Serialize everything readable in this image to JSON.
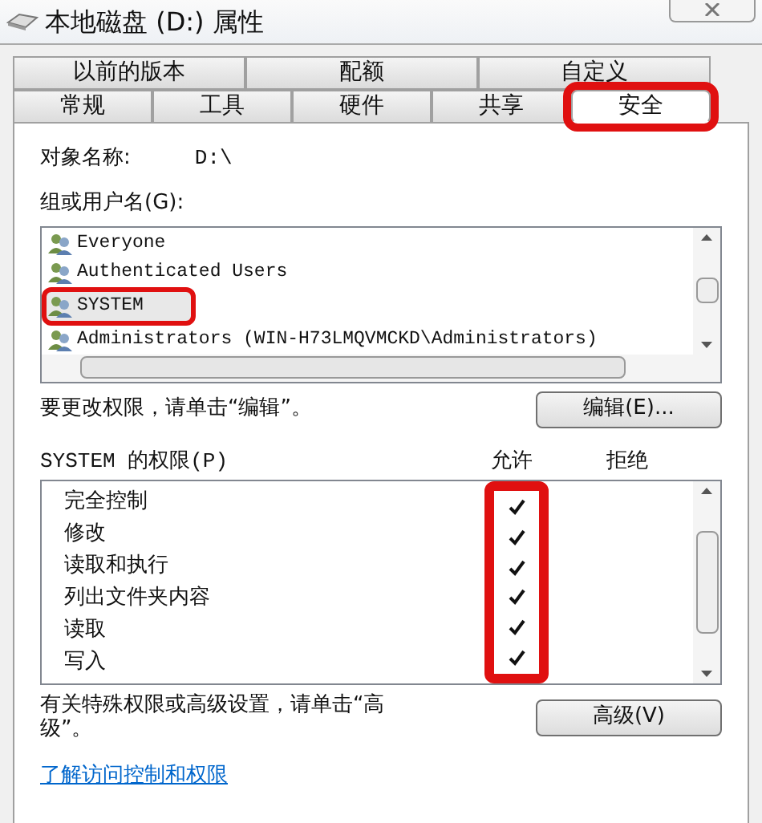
{
  "window": {
    "title": "本地磁盘 (D:) 属性"
  },
  "tabs_back": [
    {
      "label": "以前的版本",
      "selected": false
    },
    {
      "label": "配额",
      "selected": false
    },
    {
      "label": "自定义",
      "selected": false
    }
  ],
  "tabs_front": [
    {
      "label": "常规",
      "selected": false,
      "highlighted": false
    },
    {
      "label": "工具",
      "selected": false,
      "highlighted": false
    },
    {
      "label": "硬件",
      "selected": false,
      "highlighted": false
    },
    {
      "label": "共享",
      "selected": false,
      "highlighted": false
    },
    {
      "label": "安全",
      "selected": true,
      "highlighted": true
    }
  ],
  "object_name": {
    "label": "对象名称:",
    "value": "D:\\"
  },
  "users": {
    "label": "组或用户名(G):",
    "items": [
      {
        "name": "Everyone",
        "selected": false,
        "highlighted": false
      },
      {
        "name": "Authenticated Users",
        "selected": false,
        "highlighted": false
      },
      {
        "name": "SYSTEM",
        "selected": true,
        "highlighted": true
      },
      {
        "name": "Administrators (WIN-H73LMQVMCKD\\Administrators)",
        "selected": false,
        "highlighted": false
      }
    ]
  },
  "edit_hint": "要更改权限，请单击“编辑”。",
  "edit_button": "编辑(E)...",
  "permissions": {
    "label": "SYSTEM 的权限(P)",
    "allow_header": "允许",
    "deny_header": "拒绝",
    "allow_highlighted": true,
    "items": [
      {
        "name": "完全控制",
        "allow": true,
        "deny": false
      },
      {
        "name": "修改",
        "allow": true,
        "deny": false
      },
      {
        "name": "读取和执行",
        "allow": true,
        "deny": false
      },
      {
        "name": "列出文件夹内容",
        "allow": true,
        "deny": false
      },
      {
        "name": "读取",
        "allow": true,
        "deny": false
      },
      {
        "name": "写入",
        "allow": true,
        "deny": false
      }
    ]
  },
  "advanced_hint": "有关特殊权限或高级设置，请单击“高级”。",
  "advanced_button": "高级(V)",
  "learn_link": "了解访问控制和权限"
}
